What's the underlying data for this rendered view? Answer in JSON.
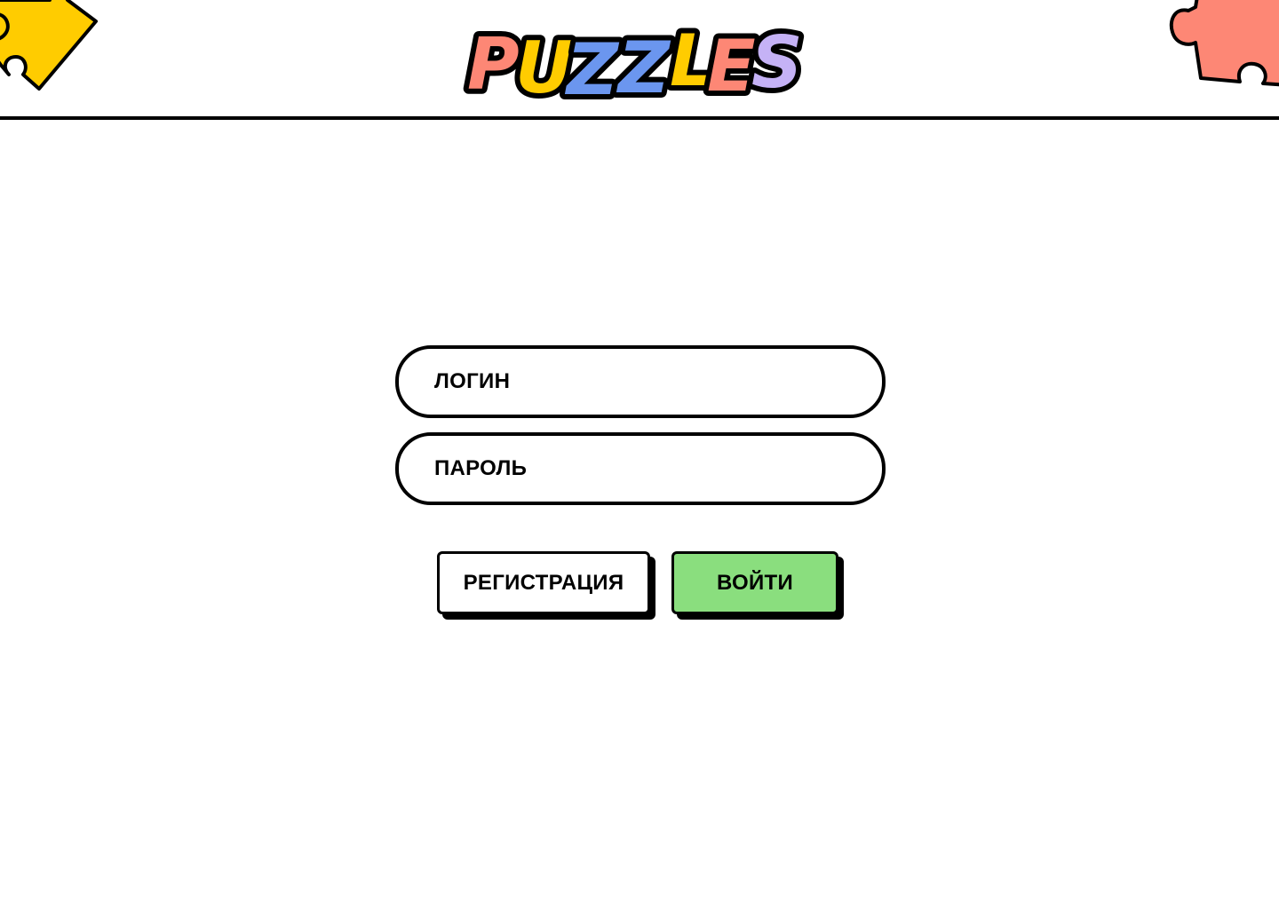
{
  "app": {
    "logo_text": "PUZZLES",
    "colors": {
      "yellow": "#ffcc00",
      "coral": "#fd8775",
      "blue": "#6b96ef",
      "lavender": "#c5b2f6",
      "green": "#8ade7e",
      "black": "#000000"
    }
  },
  "login_form": {
    "login_placeholder": "ЛОГИН",
    "password_placeholder": "ПАРОЛЬ",
    "register_label": "РЕГИСТРАЦИЯ",
    "submit_label": "ВОЙТИ"
  },
  "decorations": {
    "left_icon": "puzzle-piece-icon",
    "right_icon": "puzzle-piece-icon"
  }
}
